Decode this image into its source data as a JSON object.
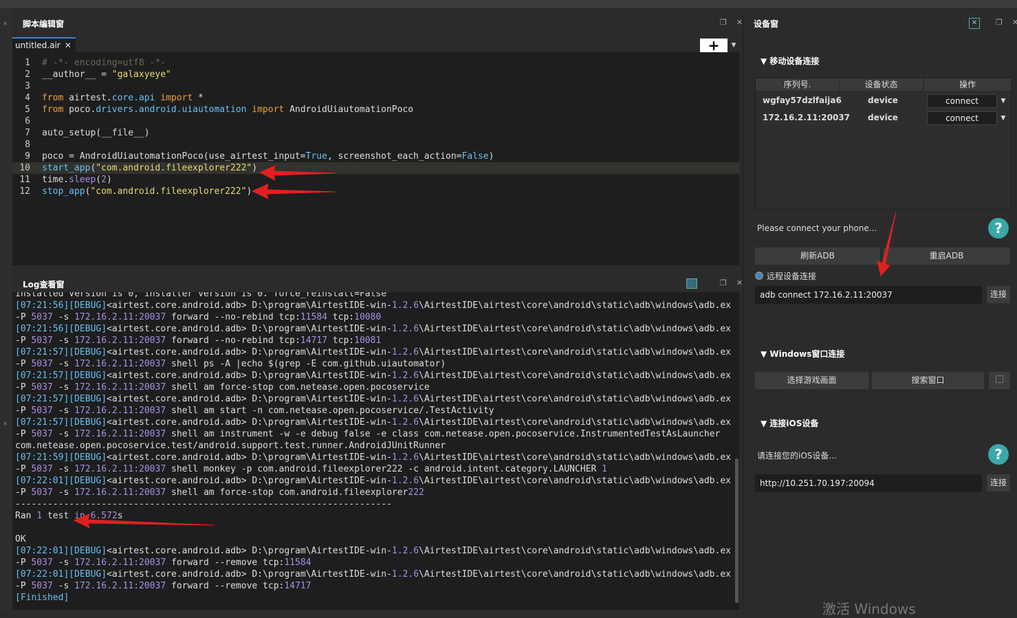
{
  "editor": {
    "title": "脚本编辑窗",
    "tab_label": "untitled.air",
    "tab_close": "✕",
    "add_button": "+",
    "lines": [
      {
        "n": "1",
        "tokens": [
          {
            "t": "# -*- encoding=utf8 -*-",
            "c": "c-com"
          }
        ]
      },
      {
        "n": "2",
        "tokens": [
          {
            "t": "__author__ = ",
            "c": "c-def"
          },
          {
            "t": "\"galaxyeye\"",
            "c": "c-str"
          }
        ]
      },
      {
        "n": "3",
        "tokens": []
      },
      {
        "n": "4",
        "tokens": [
          {
            "t": "from",
            "c": "c-kw"
          },
          {
            "t": " airtest.",
            "c": "c-def"
          },
          {
            "t": "core.api",
            "c": "c-bi"
          },
          {
            "t": " import ",
            "c": "c-kw"
          },
          {
            "t": "*",
            "c": "c-def"
          }
        ]
      },
      {
        "n": "5",
        "tokens": [
          {
            "t": "from",
            "c": "c-kw"
          },
          {
            "t": " poco.",
            "c": "c-def"
          },
          {
            "t": "drivers.android.uiautomation",
            "c": "c-bi"
          },
          {
            "t": " import ",
            "c": "c-kw"
          },
          {
            "t": "AndroidUiautomationPoco",
            "c": "c-def"
          }
        ]
      },
      {
        "n": "6",
        "tokens": []
      },
      {
        "n": "7",
        "tokens": [
          {
            "t": "auto_setup(__file__)",
            "c": "c-def"
          }
        ]
      },
      {
        "n": "8",
        "tokens": []
      },
      {
        "n": "9",
        "tokens": [
          {
            "t": "poco = AndroidUiautomationPoco(use_airtest_input=",
            "c": "c-def"
          },
          {
            "t": "True",
            "c": "c-bi"
          },
          {
            "t": ", screenshot_each_action=",
            "c": "c-def"
          },
          {
            "t": "False",
            "c": "c-bi"
          },
          {
            "t": ")",
            "c": "c-def"
          }
        ]
      },
      {
        "n": "10",
        "tokens": [
          {
            "t": "start_app",
            "c": "c-bi"
          },
          {
            "t": "(",
            "c": "c-def"
          },
          {
            "t": "\"com.android.fileexplorer222\"",
            "c": "c-str"
          },
          {
            "t": ")",
            "c": "c-def"
          }
        ]
      },
      {
        "n": "11",
        "tokens": [
          {
            "t": "time.",
            "c": "c-def"
          },
          {
            "t": "sleep",
            "c": "c-fn"
          },
          {
            "t": "(",
            "c": "c-def"
          },
          {
            "t": "2",
            "c": "c-num"
          },
          {
            "t": ")",
            "c": "c-def"
          }
        ]
      },
      {
        "n": "12",
        "tokens": [
          {
            "t": "stop_app",
            "c": "c-bi"
          },
          {
            "t": "(",
            "c": "c-def"
          },
          {
            "t": "\"com.android.fileexplorer222\"",
            "c": "c-str"
          },
          {
            "t": ")",
            "c": "c-def"
          }
        ]
      }
    ]
  },
  "log": {
    "title": "Log查看窗",
    "lines": [
      [
        {
          "t": "installed version is 0, installer version is 0. force_reinstall=False",
          "c": "c-def"
        }
      ],
      [
        {
          "t": "[07:21:56][DEBUG]",
          "c": "c-ts"
        },
        {
          "t": "<airtest.core.android.adb> D:\\program\\AirtestIDE-win-",
          "c": "c-def"
        },
        {
          "t": "1.2.6",
          "c": "c-num"
        },
        {
          "t": "\\AirtestIDE\\airtest\\core\\android\\static\\adb\\windows\\adb.exe",
          "c": "c-def"
        }
      ],
      [
        {
          "t": "-P ",
          "c": "c-def"
        },
        {
          "t": "5037",
          "c": "c-num"
        },
        {
          "t": " -s ",
          "c": "c-def"
        },
        {
          "t": "172.16.2.11:20037",
          "c": "c-num"
        },
        {
          "t": " forward --no-rebind tcp:",
          "c": "c-def"
        },
        {
          "t": "11584",
          "c": "c-num"
        },
        {
          "t": " tcp:",
          "c": "c-def"
        },
        {
          "t": "10080",
          "c": "c-num"
        }
      ],
      [
        {
          "t": "[07:21:56][DEBUG]",
          "c": "c-ts"
        },
        {
          "t": "<airtest.core.android.adb> D:\\program\\AirtestIDE-win-",
          "c": "c-def"
        },
        {
          "t": "1.2.6",
          "c": "c-num"
        },
        {
          "t": "\\AirtestIDE\\airtest\\core\\android\\static\\adb\\windows\\adb.exe",
          "c": "c-def"
        }
      ],
      [
        {
          "t": "-P ",
          "c": "c-def"
        },
        {
          "t": "5037",
          "c": "c-num"
        },
        {
          "t": " -s ",
          "c": "c-def"
        },
        {
          "t": "172.16.2.11:20037",
          "c": "c-num"
        },
        {
          "t": " forward --no-rebind tcp:",
          "c": "c-def"
        },
        {
          "t": "14717",
          "c": "c-num"
        },
        {
          "t": " tcp:",
          "c": "c-def"
        },
        {
          "t": "10081",
          "c": "c-num"
        }
      ],
      [
        {
          "t": "[07:21:57][DEBUG]",
          "c": "c-ts"
        },
        {
          "t": "<airtest.core.android.adb> D:\\program\\AirtestIDE-win-",
          "c": "c-def"
        },
        {
          "t": "1.2.6",
          "c": "c-num"
        },
        {
          "t": "\\AirtestIDE\\airtest\\core\\android\\static\\adb\\windows\\adb.exe",
          "c": "c-def"
        }
      ],
      [
        {
          "t": "-P ",
          "c": "c-def"
        },
        {
          "t": "5037",
          "c": "c-num"
        },
        {
          "t": " -s ",
          "c": "c-def"
        },
        {
          "t": "172.16.2.11:20037",
          "c": "c-num"
        },
        {
          "t": " shell ps -A |echo $(grep -E com.github.uiautomator)",
          "c": "c-def"
        }
      ],
      [
        {
          "t": "[07:21:57][DEBUG]",
          "c": "c-ts"
        },
        {
          "t": "<airtest.core.android.adb> D:\\program\\AirtestIDE-win-",
          "c": "c-def"
        },
        {
          "t": "1.2.6",
          "c": "c-num"
        },
        {
          "t": "\\AirtestIDE\\airtest\\core\\android\\static\\adb\\windows\\adb.exe",
          "c": "c-def"
        }
      ],
      [
        {
          "t": "-P ",
          "c": "c-def"
        },
        {
          "t": "5037",
          "c": "c-num"
        },
        {
          "t": " -s ",
          "c": "c-def"
        },
        {
          "t": "172.16.2.11:20037",
          "c": "c-num"
        },
        {
          "t": " shell am force-stop com.netease.open.pocoservice",
          "c": "c-def"
        }
      ],
      [
        {
          "t": "[07:21:57][DEBUG]",
          "c": "c-ts"
        },
        {
          "t": "<airtest.core.android.adb> D:\\program\\AirtestIDE-win-",
          "c": "c-def"
        },
        {
          "t": "1.2.6",
          "c": "c-num"
        },
        {
          "t": "\\AirtestIDE\\airtest\\core\\android\\static\\adb\\windows\\adb.exe",
          "c": "c-def"
        }
      ],
      [
        {
          "t": "-P ",
          "c": "c-def"
        },
        {
          "t": "5037",
          "c": "c-num"
        },
        {
          "t": " -s ",
          "c": "c-def"
        },
        {
          "t": "172.16.2.11:20037",
          "c": "c-num"
        },
        {
          "t": " shell am start -n com.netease.open.pocoservice/.TestActivity",
          "c": "c-def"
        }
      ],
      [
        {
          "t": "[07:21:57][DEBUG]",
          "c": "c-ts"
        },
        {
          "t": "<airtest.core.android.adb> D:\\program\\AirtestIDE-win-",
          "c": "c-def"
        },
        {
          "t": "1.2.6",
          "c": "c-num"
        },
        {
          "t": "\\AirtestIDE\\airtest\\core\\android\\static\\adb\\windows\\adb.exe",
          "c": "c-def"
        }
      ],
      [
        {
          "t": "-P ",
          "c": "c-def"
        },
        {
          "t": "5037",
          "c": "c-num"
        },
        {
          "t": " -s ",
          "c": "c-def"
        },
        {
          "t": "172.16.2.11:20037",
          "c": "c-num"
        },
        {
          "t": " shell am instrument -w -e debug false -e class com.netease.open.pocoservice.InstrumentedTestAsLauncher",
          "c": "c-def"
        }
      ],
      [
        {
          "t": "com.netease.open.pocoservice.test/android.support.test.runner.AndroidJUnitRunner",
          "c": "c-def"
        }
      ],
      [
        {
          "t": "[07:21:59][DEBUG]",
          "c": "c-ts"
        },
        {
          "t": "<airtest.core.android.adb> D:\\program\\AirtestIDE-win-",
          "c": "c-def"
        },
        {
          "t": "1.2.6",
          "c": "c-num"
        },
        {
          "t": "\\AirtestIDE\\airtest\\core\\android\\static\\adb\\windows\\adb.exe",
          "c": "c-def"
        }
      ],
      [
        {
          "t": "-P ",
          "c": "c-def"
        },
        {
          "t": "5037",
          "c": "c-num"
        },
        {
          "t": " -s ",
          "c": "c-def"
        },
        {
          "t": "172.16.2.11:20037",
          "c": "c-num"
        },
        {
          "t": " shell monkey -p com.android.fileexplorer222 -c android.intent.category.LAUNCHER ",
          "c": "c-def"
        },
        {
          "t": "1",
          "c": "c-num"
        }
      ],
      [
        {
          "t": "[07:22:01][DEBUG]",
          "c": "c-ts"
        },
        {
          "t": "<airtest.core.android.adb> D:\\program\\AirtestIDE-win-",
          "c": "c-def"
        },
        {
          "t": "1.2.6",
          "c": "c-num"
        },
        {
          "t": "\\AirtestIDE\\airtest\\core\\android\\static\\adb\\windows\\adb.exe",
          "c": "c-def"
        }
      ],
      [
        {
          "t": "-P ",
          "c": "c-def"
        },
        {
          "t": "5037",
          "c": "c-num"
        },
        {
          "t": " -s ",
          "c": "c-def"
        },
        {
          "t": "172.16.2.11:20037",
          "c": "c-num"
        },
        {
          "t": " shell am force-stop com.android.fileexplorer",
          "c": "c-def"
        },
        {
          "t": "222",
          "c": "c-num"
        }
      ],
      [
        {
          "t": "----------------------------------------------------------------------",
          "c": "c-def"
        }
      ],
      [
        {
          "t": "Ran ",
          "c": "c-def"
        },
        {
          "t": "1",
          "c": "c-num"
        },
        {
          "t": " test ",
          "c": "c-def"
        },
        {
          "t": "in",
          "c": "c-num"
        },
        {
          "t": " ",
          "c": "c-def"
        },
        {
          "t": "6.572",
          "c": "c-num"
        },
        {
          "t": "s",
          "c": "c-def"
        }
      ],
      [],
      [
        {
          "t": "OK",
          "c": "c-def"
        }
      ],
      [
        {
          "t": "[07:22:01][DEBUG]",
          "c": "c-ts"
        },
        {
          "t": "<airtest.core.android.adb> D:\\program\\AirtestIDE-win-",
          "c": "c-def"
        },
        {
          "t": "1.2.6",
          "c": "c-num"
        },
        {
          "t": "\\AirtestIDE\\airtest\\core\\android\\static\\adb\\windows\\adb.exe",
          "c": "c-def"
        }
      ],
      [
        {
          "t": "-P ",
          "c": "c-def"
        },
        {
          "t": "5037",
          "c": "c-num"
        },
        {
          "t": " -s ",
          "c": "c-def"
        },
        {
          "t": "172.16.2.11:20037",
          "c": "c-num"
        },
        {
          "t": " forward --remove tcp:",
          "c": "c-def"
        },
        {
          "t": "11584",
          "c": "c-num"
        }
      ],
      [
        {
          "t": "[07:22:01][DEBUG]",
          "c": "c-ts"
        },
        {
          "t": "<airtest.core.android.adb> D:\\program\\AirtestIDE-win-",
          "c": "c-def"
        },
        {
          "t": "1.2.6",
          "c": "c-num"
        },
        {
          "t": "\\AirtestIDE\\airtest\\core\\android\\static\\adb\\windows\\adb.exe",
          "c": "c-def"
        }
      ],
      [
        {
          "t": "-P ",
          "c": "c-def"
        },
        {
          "t": "5037",
          "c": "c-num"
        },
        {
          "t": " -s ",
          "c": "c-def"
        },
        {
          "t": "172.16.2.11:20037",
          "c": "c-num"
        },
        {
          "t": " forward --remove tcp:",
          "c": "c-def"
        },
        {
          "t": "14717",
          "c": "c-num"
        }
      ],
      [
        {
          "t": "[Finished]",
          "c": "c-ts"
        }
      ]
    ]
  },
  "device": {
    "title": "设备窗",
    "mobile_section": "移动设备连接",
    "columns": [
      "序列号.",
      "设备状态",
      "操作"
    ],
    "rows": [
      {
        "serial": "wgfay57dzlfaija6",
        "status": "device",
        "action": "connect"
      },
      {
        "serial": "172.16.2.11:20037",
        "status": "device",
        "action": "connect"
      }
    ],
    "please_connect": "Please connect your phone...",
    "refresh_adb": "刷新ADB",
    "restart_adb": "重启ADB",
    "remote_label": "远程设备连接",
    "remote_value": "adb connect 172.16.2.11:20037",
    "connect_label": "连接",
    "windows_section": "Windows窗口连接",
    "select_game": "选择游戏画面",
    "search_window": "搜索窗口",
    "ios_section": "连接iOS设备",
    "ios_hint": "请连接您的iOS设备...",
    "ios_value": "http://10.251.70.197:20094",
    "ios_connect_label": "连接",
    "help_glyph": "?",
    "watermark": "激活 Windows"
  },
  "colors": {
    "accent": "#3a86d1",
    "arrow": "#e02020",
    "help": "#3aa8a8"
  }
}
